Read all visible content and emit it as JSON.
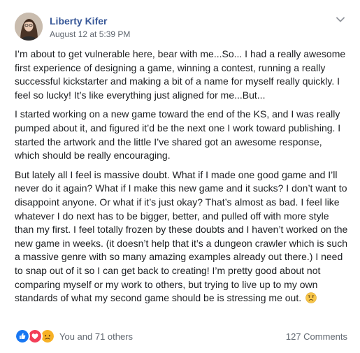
{
  "post": {
    "author": "Liberty Kifer",
    "timestamp": "August 12 at 5:39 PM",
    "paragraphs": [
      "I’m about to get vulnerable here, bear with me...So... I had a really awesome first experience of designing a game, winning a contest, running a really successful kickstarter and making a bit of a name for myself really quickly. I feel so lucky! It’s like everything just aligned for me...But...",
      "I started working on a new game toward the end of the KS, and I was really pumped about it, and figured it’d be the next one I work toward publishing. I started the artwork and the little I’ve shared got an awesome response, which should be really encouraging.",
      "But lately all I feel is massive doubt. What if I made one good game and I’ll never do it again? What if I make this new game and it sucks? I don’t want to disappoint anyone. Or what if it’s just okay? That’s almost as bad. I feel like whatever I do next has to be bigger, better, and pulled off with more style than my first. I feel totally frozen by these doubts and I haven’t worked on the new game in weeks. (it doesn’t help that it’s a dungeon crawler which is such a massive genre with so many amazing examples already out there.) I need to snap out of it so I can get back to creating! I’m pretty good about not comparing myself or my work to others, but trying to live up to my own standards of what my second game should be is stressing me out."
    ],
    "trailing_emoji": "worried-face-emoji"
  },
  "footer": {
    "reactions": [
      "like-reaction-icon",
      "love-reaction-icon",
      "sad-reaction-icon"
    ],
    "reactions_text": "You and 71 others",
    "comments_text": "127 Comments"
  },
  "colors": {
    "author_link": "#385898",
    "secondary_text": "#606770",
    "body_text": "#1c1e21",
    "like_blue": "#1877f2",
    "love_red": "#f33e58",
    "sad_yellow": "#f7b125"
  },
  "icons": {
    "options": "chevron-down-icon"
  }
}
